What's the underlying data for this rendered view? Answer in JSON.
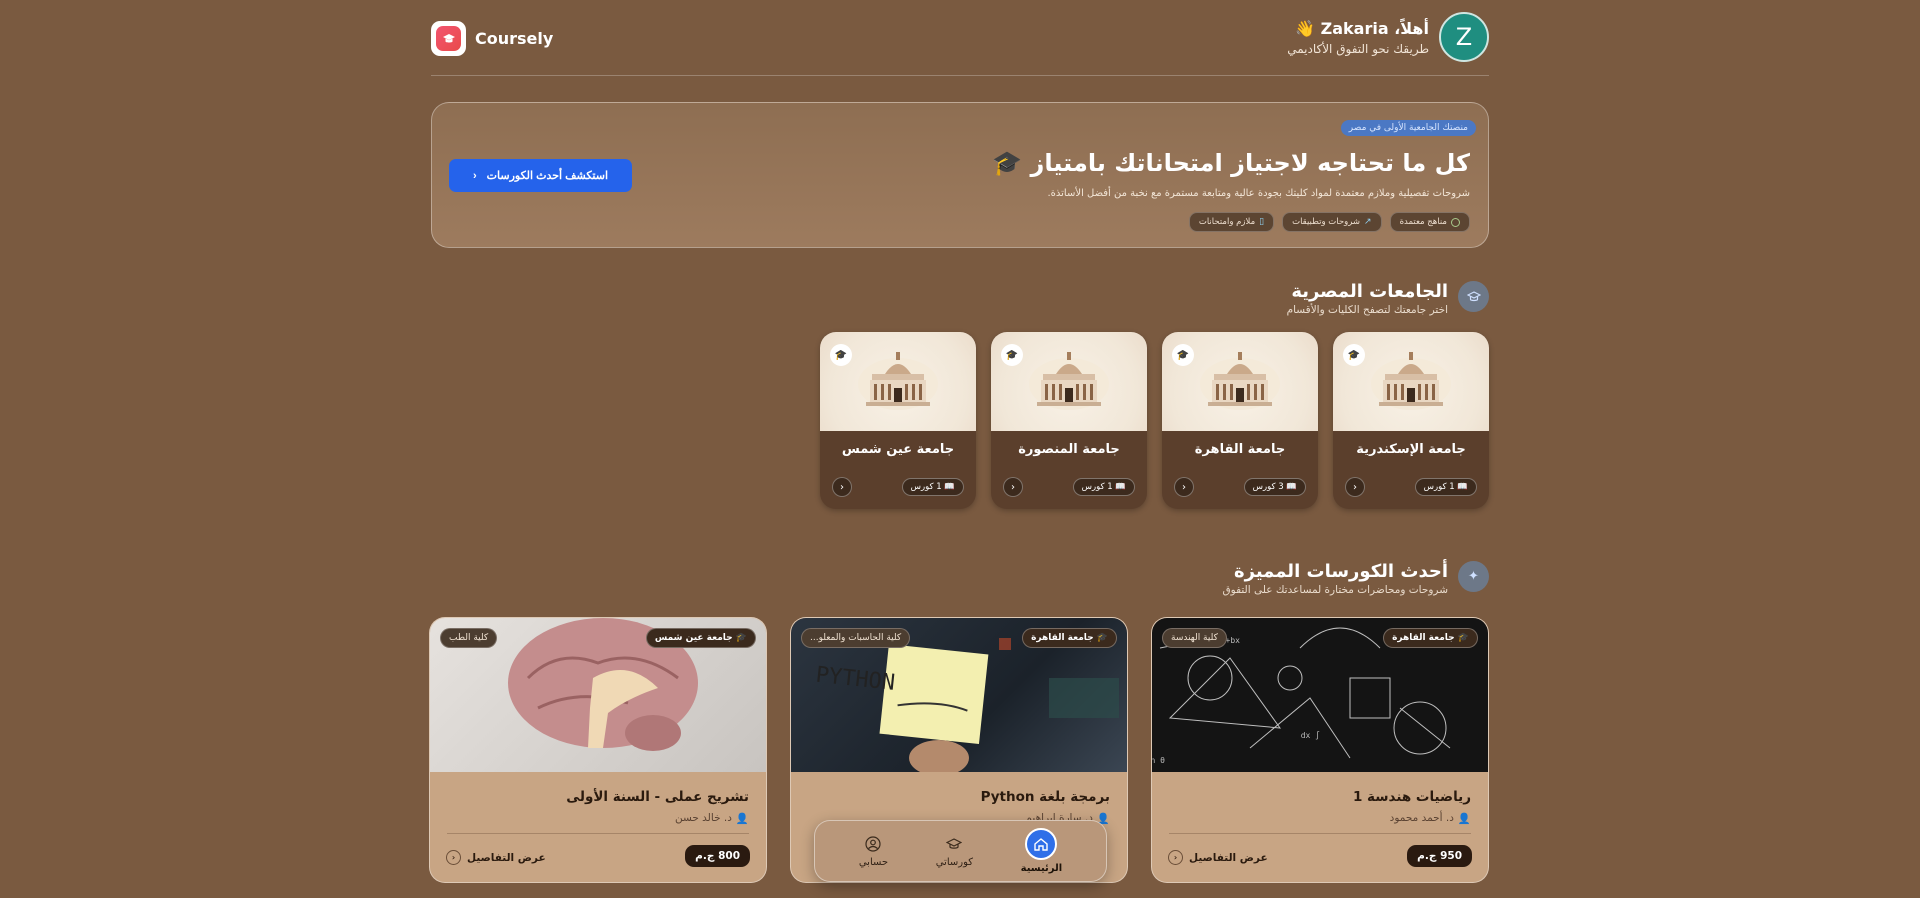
{
  "brand": {
    "name": "Coursely",
    "logo_icon": "graduation-cap-icon"
  },
  "user": {
    "greeting": "أهلاً، Zakaria 👋",
    "tagline": "طريقك نحو التفوق الأكاديمي",
    "avatar_letter": "Z"
  },
  "hero": {
    "badge": "منصتك الجامعية الأولى في مصر",
    "title": "كل ما تحتاجه لاجتياز امتحاناتك بامتياز 🎓",
    "subtitle": "شروحات تفصيلية وملازم معتمدة لمواد كليتك بجودة عالية ومتابعة مستمرة مع نخبة من أفضل الأساتذة.",
    "tags": [
      "مناهج معتمدة",
      "شروحات وتطبيقات",
      "ملازم وامتحانات"
    ],
    "cta_label": "استكشف أحدث الكورسات"
  },
  "universities_section": {
    "title": "الجامعات المصرية",
    "subtitle": "اختر جامعتك لتصفح الكليات والأقسام",
    "items": [
      {
        "name": "جامعة الإسكندرية",
        "count": "1 كورس"
      },
      {
        "name": "جامعة القاهرة",
        "count": "3 كورس"
      },
      {
        "name": "جامعة المنصورة",
        "count": "1 كورس"
      },
      {
        "name": "جامعة عين شمس",
        "count": "1 كورس"
      }
    ]
  },
  "courses_section": {
    "title": "أحدث الكورسات المميزة",
    "subtitle": "شروحات ومحاضرات مختارة لمساعدتك على التفوق",
    "items": [
      {
        "university": "جامعة القاهرة",
        "faculty": "كلية الهندسة",
        "title": "رياضيات هندسة 1",
        "instructor": "د. أحمد محمود",
        "price": "950 ج.م",
        "details": "عرض التفاصيل"
      },
      {
        "university": "جامعة القاهرة",
        "faculty": "كلية الحاسبات والمعلو...",
        "title": "برمجة بلغة Python",
        "instructor": "د. سارة ابراهيم",
        "price": "",
        "details": ""
      },
      {
        "university": "جامعة عين شمس",
        "faculty": "كلية الطب",
        "title": "تشريح عملى - السنة الأولى",
        "instructor": "د. خالد حسن",
        "price": "800 ج.م",
        "details": "عرض التفاصيل"
      }
    ]
  },
  "bottom_nav": {
    "items": [
      "الرئيسية",
      "كورساتي",
      "حسابي"
    ],
    "active": "الرئيسية"
  },
  "colors": {
    "background": "#7a5a40",
    "accent": "#2563eb",
    "avatar": "#1f8e80"
  }
}
